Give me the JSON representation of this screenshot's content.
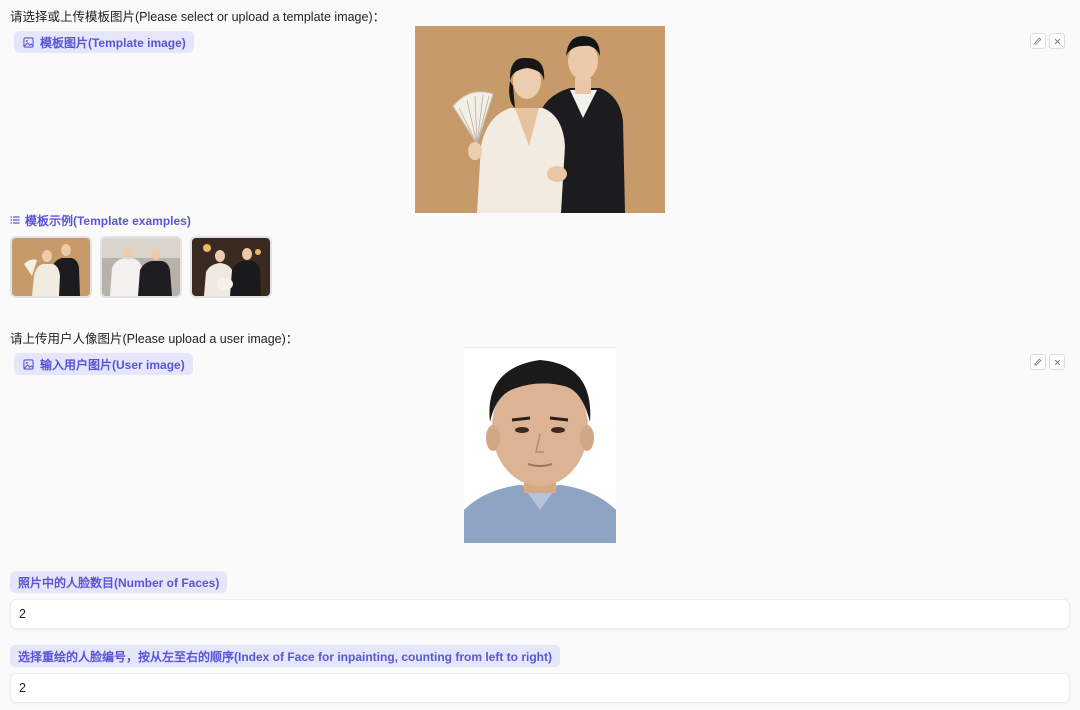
{
  "template": {
    "prompt": "请选择或上传模板图片(Please select or upload a template image)：",
    "label": "模板图片(Template image)",
    "icon": "image-icon"
  },
  "examples": {
    "label": "模板示例(Template examples)",
    "icon": "list-icon",
    "count": 3
  },
  "user": {
    "prompt": "请上传用户人像图片(Please upload a user image)：",
    "label": "输入用户图片(User image)",
    "icon": "image-icon"
  },
  "faces": {
    "label": "照片中的人脸数目(Number of Faces)",
    "value": "2"
  },
  "index": {
    "label": "选择重绘的人脸编号，按从左至右的顺序(Index of Face for inpainting, counting from left to right)",
    "value": "2"
  },
  "colors": {
    "accent": "#5a55d6",
    "pill_bg": "#e6e6fb",
    "background": "#fafafb",
    "template_bg": "#c69a69"
  },
  "tools": {
    "edit_icon": "pencil-icon",
    "clear_icon": "close-icon"
  }
}
